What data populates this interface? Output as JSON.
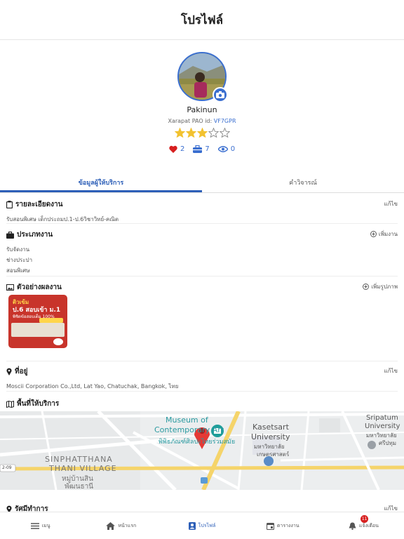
{
  "header": {
    "title": "โปรไฟล์"
  },
  "profile": {
    "name": "Pakinun",
    "id_label": "Xarapat PAO id:",
    "id_code": "VF7GPR",
    "rating": 3,
    "rating_max": 5,
    "likes": "2",
    "jobs": "7",
    "views": "0"
  },
  "tabs": [
    {
      "label": "ข้อมูลผู้ให้บริการ",
      "active": true
    },
    {
      "label": "คำวิจารณ์",
      "active": false
    }
  ],
  "sections": {
    "details": {
      "title": "รายละเอียดงาน",
      "action": "แก้ไข",
      "body": "รับสอนพิเศษ เด็กประถมป.1-ป.6วิชาวิทย์-คณิต"
    },
    "work_types": {
      "title": "ประเภทงาน",
      "action": "เพิ่มงาน",
      "items": [
        "รับจัดงาน",
        "ช่างประปา",
        "สอนพิเศษ"
      ]
    },
    "portfolio": {
      "title": "ตัวอย่างผลงาน",
      "action": "เพิ่มรูปภาพ",
      "poster": {
        "line1": "ติวเข้ม",
        "line2": "ป.6 สอบเข้า ม.1",
        "line3": "พิชิตข้อสอบเต็ม 100%"
      }
    },
    "address": {
      "title": "ที่อยู่",
      "action": "แก้ไข",
      "body": "Moscii Corporation Co.,Ltd, Lat Yao, Chatuchak, Bangkok, ไทย"
    },
    "service_area": {
      "title": "พื้นที่ให้บริการ",
      "map_labels": {
        "museum1": "Museum of",
        "museum2": "Contemporary Art",
        "museum_th": "พิพิธภัณฑ์ศิลปะไทยร่วมสมัย",
        "kasetsart1": "Kasetsart",
        "kasetsart2": "University",
        "kasetsart_th1": "มหาวิทยาลัย",
        "kasetsart_th2": "เกษตรศาสตร์",
        "sripatum1": "Sripatum",
        "sripatum2": "University",
        "sripatum_th1": "มหาวิทยาลัย",
        "sripatum_th2": "ศรีปทุม",
        "village1": "SINPHATTHANA",
        "village2": "THANI VILLAGE",
        "village_th1": "หมู่บ้านสิน",
        "village_th2": "พัฒนธานี",
        "road": "2-09"
      }
    },
    "team": {
      "title": "รัศมีทำการ",
      "action": "แก้ไข"
    }
  },
  "bottom_nav": [
    {
      "label": "เมนู",
      "icon": "menu-icon"
    },
    {
      "label": "หน้าแรก",
      "icon": "home-icon"
    },
    {
      "label": "โปรไฟล์",
      "icon": "profile-icon",
      "active": true
    },
    {
      "label": "ตารางงาน",
      "icon": "calendar-icon"
    },
    {
      "label": "แจ้งเตือน",
      "icon": "bell-icon",
      "badge": "11"
    }
  ],
  "colors": {
    "accent": "#2d5fb8",
    "star": "#f2c230",
    "heart": "#d71f1f",
    "badge": "#d71f1f"
  }
}
